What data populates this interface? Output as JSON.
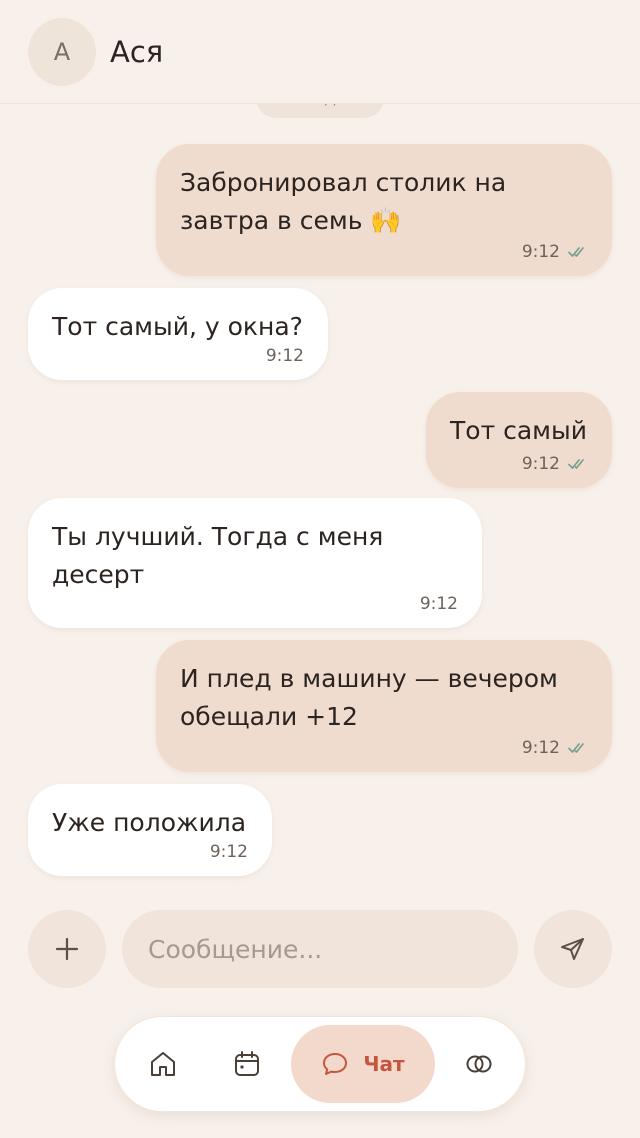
{
  "header": {
    "avatar_initial": "А",
    "contact_name": "Ася"
  },
  "date_chip": "Сегодня",
  "messages": [
    {
      "direction": "out",
      "text": "Забронировал столик на\nзавтра в семь 🙌",
      "time": "9:12",
      "read": true
    },
    {
      "direction": "in",
      "text": "Тот самый, у окна?",
      "time": "9:12"
    },
    {
      "direction": "out",
      "text": "Тот самый",
      "time": "9:12",
      "read": true
    },
    {
      "direction": "in",
      "text": "Ты лучший. Тогда с меня\nдесерт",
      "time": "9:12"
    },
    {
      "direction": "out",
      "text": "И плед в машину — вечером\nобещали +12",
      "time": "9:12",
      "read": true
    },
    {
      "direction": "in",
      "text": "Уже положила",
      "time": "9:12"
    }
  ],
  "composer": {
    "placeholder": "Сообщение...",
    "add_icon": "plus-icon",
    "send_icon": "send-icon"
  },
  "nav": {
    "items": [
      {
        "icon": "home-icon",
        "label": ""
      },
      {
        "icon": "calendar-icon",
        "label": ""
      },
      {
        "icon": "chat-icon",
        "label": "Чат",
        "active": true
      },
      {
        "icon": "rings-icon",
        "label": ""
      }
    ]
  },
  "colors": {
    "background": "#f8f1eb",
    "outgoing_bubble": "#f0dbcf",
    "incoming_bubble": "#ffffff",
    "accent": "#c4553e",
    "read_check": "#6fa08a"
  }
}
